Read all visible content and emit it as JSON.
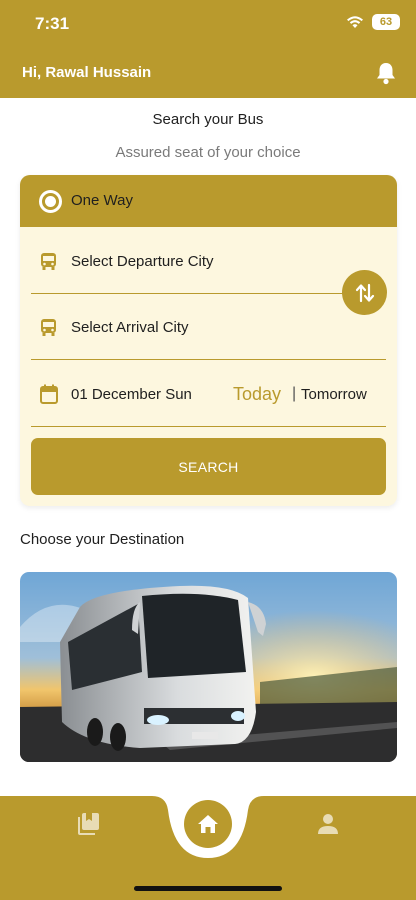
{
  "status": {
    "time": "7:31",
    "battery": "63"
  },
  "header": {
    "greeting": "Hi, Rawal Hussain"
  },
  "search": {
    "title": "Search your Bus",
    "subtitle": "Assured seat of your choice"
  },
  "trip": {
    "type_label": "One Way",
    "departure_placeholder": "Select Departure City",
    "arrival_placeholder": "Select Arrival City",
    "date": "01 December Sun",
    "today_label": "Today",
    "separator": "|",
    "tomorrow_label": "Tomorrow",
    "search_button": "SEARCH"
  },
  "destination": {
    "title": "Choose your Destination"
  },
  "colors": {
    "accent": "#b99a2d",
    "card_bg": "#fdf7df"
  },
  "icons": {
    "bell": "bell-icon",
    "radio": "radio-selected-icon",
    "bus": "bus-icon",
    "swap": "swap-vertical-icon",
    "calendar": "calendar-icon",
    "bookings": "bookings-icon",
    "home": "home-icon",
    "profile": "profile-icon"
  }
}
